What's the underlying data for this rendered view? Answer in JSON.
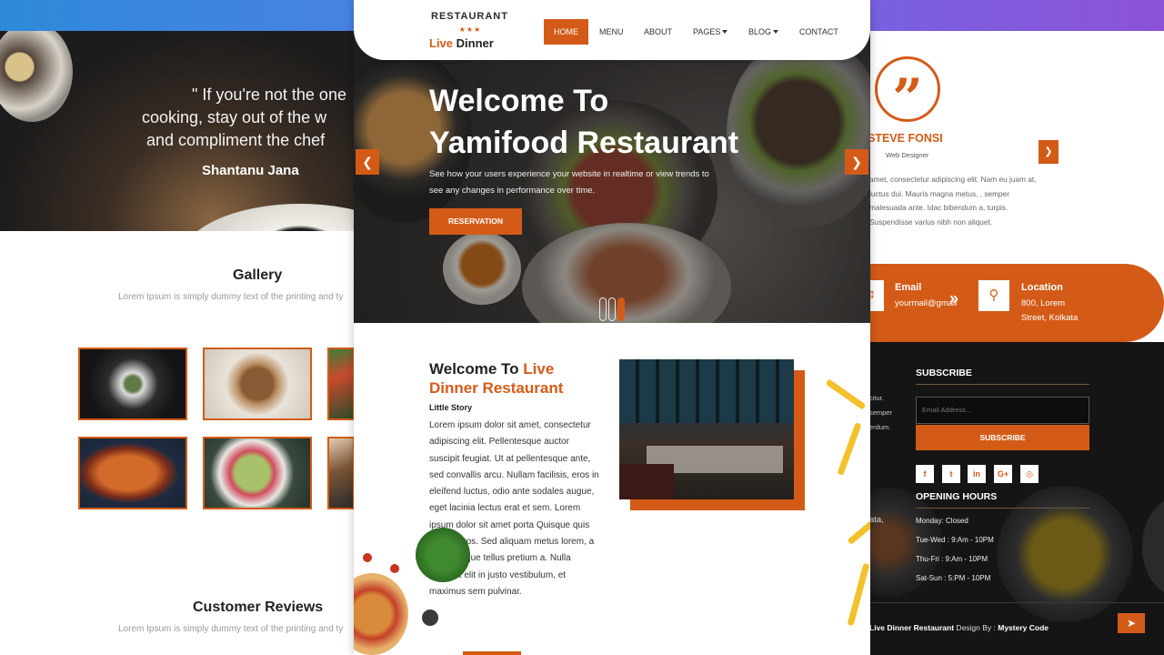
{
  "brand": {
    "orange": "#d35b17",
    "dark": "#151515"
  },
  "left": {
    "quote": {
      "lines": [
        "\" If you're not the one",
        "cooking, stay out of the w",
        "and compliment the chef"
      ],
      "author": "Shantanu Jana"
    },
    "gallery": {
      "title": "Gallery",
      "subtitle": "Lorem Ipsum is simply dummy text of the printing and ty"
    },
    "reviews": {
      "title": "Customer Reviews",
      "subtitle": "Lorem Ipsum is simply dummy text of the printing and ty"
    }
  },
  "center": {
    "logo": {
      "top": "RESTAURANT",
      "stars": "★★★",
      "main_a": "Live ",
      "main_b": "Dinner"
    },
    "nav": {
      "home": "HOME",
      "menu": "MENU",
      "about": "ABOUT",
      "pages": "PAGES",
      "blog": "BLOG",
      "contact": "CONTACT"
    },
    "hero": {
      "title_line1": "Welcome To",
      "title_line2": "Yamifood Restaurant",
      "text": "See how your users experience your website in realtime or view trends to see any changes in performance over time.",
      "button": "RESERVATION",
      "prev_icon": "chevron-left-icon",
      "next_icon": "chevron-right-icon"
    },
    "about": {
      "title_a": "Welcome To ",
      "title_b": "Live",
      "title_c": "Dinner Restaurant",
      "subtitle": "Little Story",
      "text": "Lorem ipsum dolor sit amet, consectetur adipiscing elit. Pellentesque auctor suscipit feugiat. Ut at pellentesque ante, sed convallis arcu. Nullam facilisis, eros in eleifend luctus, odio ante sodales augue, eget lacinia lectus erat et sem. Lorem ipsum dolor sit amet porta Quisque quis finibus eros. Sed aliquam metus lorem, a pellentesque tellus pretium a. Nulla placerat elit in justo vestibulum, et maximus sem pulvinar."
    }
  },
  "right": {
    "review": {
      "quote_mark": "”",
      "name": "STEVE FONSI",
      "role": "Web Designer",
      "text": "amet, consectetur adipiscing elit. Nam eu juam at, luctus dui. Mauris magna metus, , semper malesuada ante. Idac bibendum a, turpis. Suspendisse varius nibh non aliquet.",
      "next_icon": "chevron-right-icon"
    },
    "contact": {
      "email_title": "Email",
      "email_value": "yourmail@gmail",
      "location_title": "Location",
      "location_line1": "800, Lorem",
      "location_line2": "Street, Kolkata"
    },
    "footer": {
      "side_lines": [
        "citur.",
        "semper",
        "erdum.",
        "",
        "",
        "",
        "",
        "",
        "",
        "ata,"
      ],
      "subscribe_title": "SUBSCRIBE",
      "email_placeholder": "Email Address...",
      "subscribe_button": "SUBSCRIBE",
      "social": [
        "f",
        "t",
        "in",
        "G+",
        "◎"
      ],
      "hours_title": "OPENING HOURS",
      "hours": [
        "Monday: Closed",
        "Tue-Wed : 9:Am - 10PM",
        "Thu-Fri : 9:Am - 10PM",
        "Sat-Sun : 5:PM - 10PM"
      ],
      "copy_a": "Live Dinner Restaurant",
      "copy_b": " Design By : ",
      "copy_c": "Mystery Code"
    }
  }
}
